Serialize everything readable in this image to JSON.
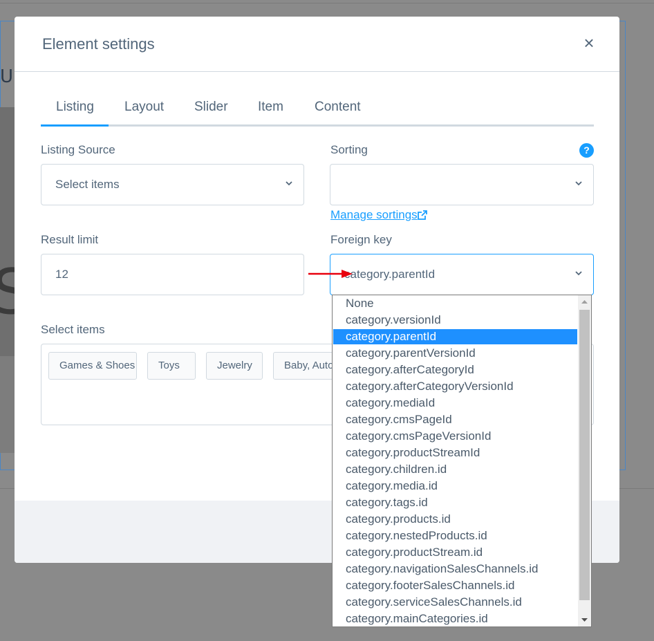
{
  "background": {
    "partial_letter_top": "U",
    "partial_letter_mid": "S"
  },
  "modal": {
    "title": "Element settings",
    "close_label": "×"
  },
  "tabs": [
    {
      "label": "Listing"
    },
    {
      "label": "Layout"
    },
    {
      "label": "Slider"
    },
    {
      "label": "Item"
    },
    {
      "label": "Content"
    }
  ],
  "listing_source": {
    "label": "Listing Source",
    "value": "Select items"
  },
  "sorting": {
    "label": "Sorting",
    "value": "",
    "help": "?",
    "manage_link": "Manage sortings"
  },
  "result_limit": {
    "label": "Result limit",
    "value": "12"
  },
  "foreign_key": {
    "label": "Foreign key",
    "value": "category.parentId"
  },
  "select_items": {
    "label": "Select items",
    "tags": [
      "Games & Shoes",
      "Toys",
      "Jewelry",
      "Baby, Automotive"
    ]
  },
  "dropdown_options": [
    "None",
    "category.versionId",
    "category.parentId",
    "category.parentVersionId",
    "category.afterCategoryId",
    "category.afterCategoryVersionId",
    "category.mediaId",
    "category.cmsPageId",
    "category.cmsPageVersionId",
    "category.productStreamId",
    "category.children.id",
    "category.media.id",
    "category.tags.id",
    "category.products.id",
    "category.nestedProducts.id",
    "category.productStream.id",
    "category.navigationSalesChannels.id",
    "category.footerSalesChannels.id",
    "category.serviceSalesChannels.id",
    "category.mainCategories.id"
  ],
  "selected_option": "category.parentId",
  "colors": {
    "accent": "#189eff",
    "text": "#52667a",
    "border": "#d1d9e0",
    "selection": "#1e90ff",
    "arrow": "#e8000d"
  },
  "icons": {
    "close": "close-icon",
    "chevron": "chevron-down-icon",
    "help": "help-icon",
    "external": "external-link-icon",
    "arrow": "red-arrow"
  }
}
